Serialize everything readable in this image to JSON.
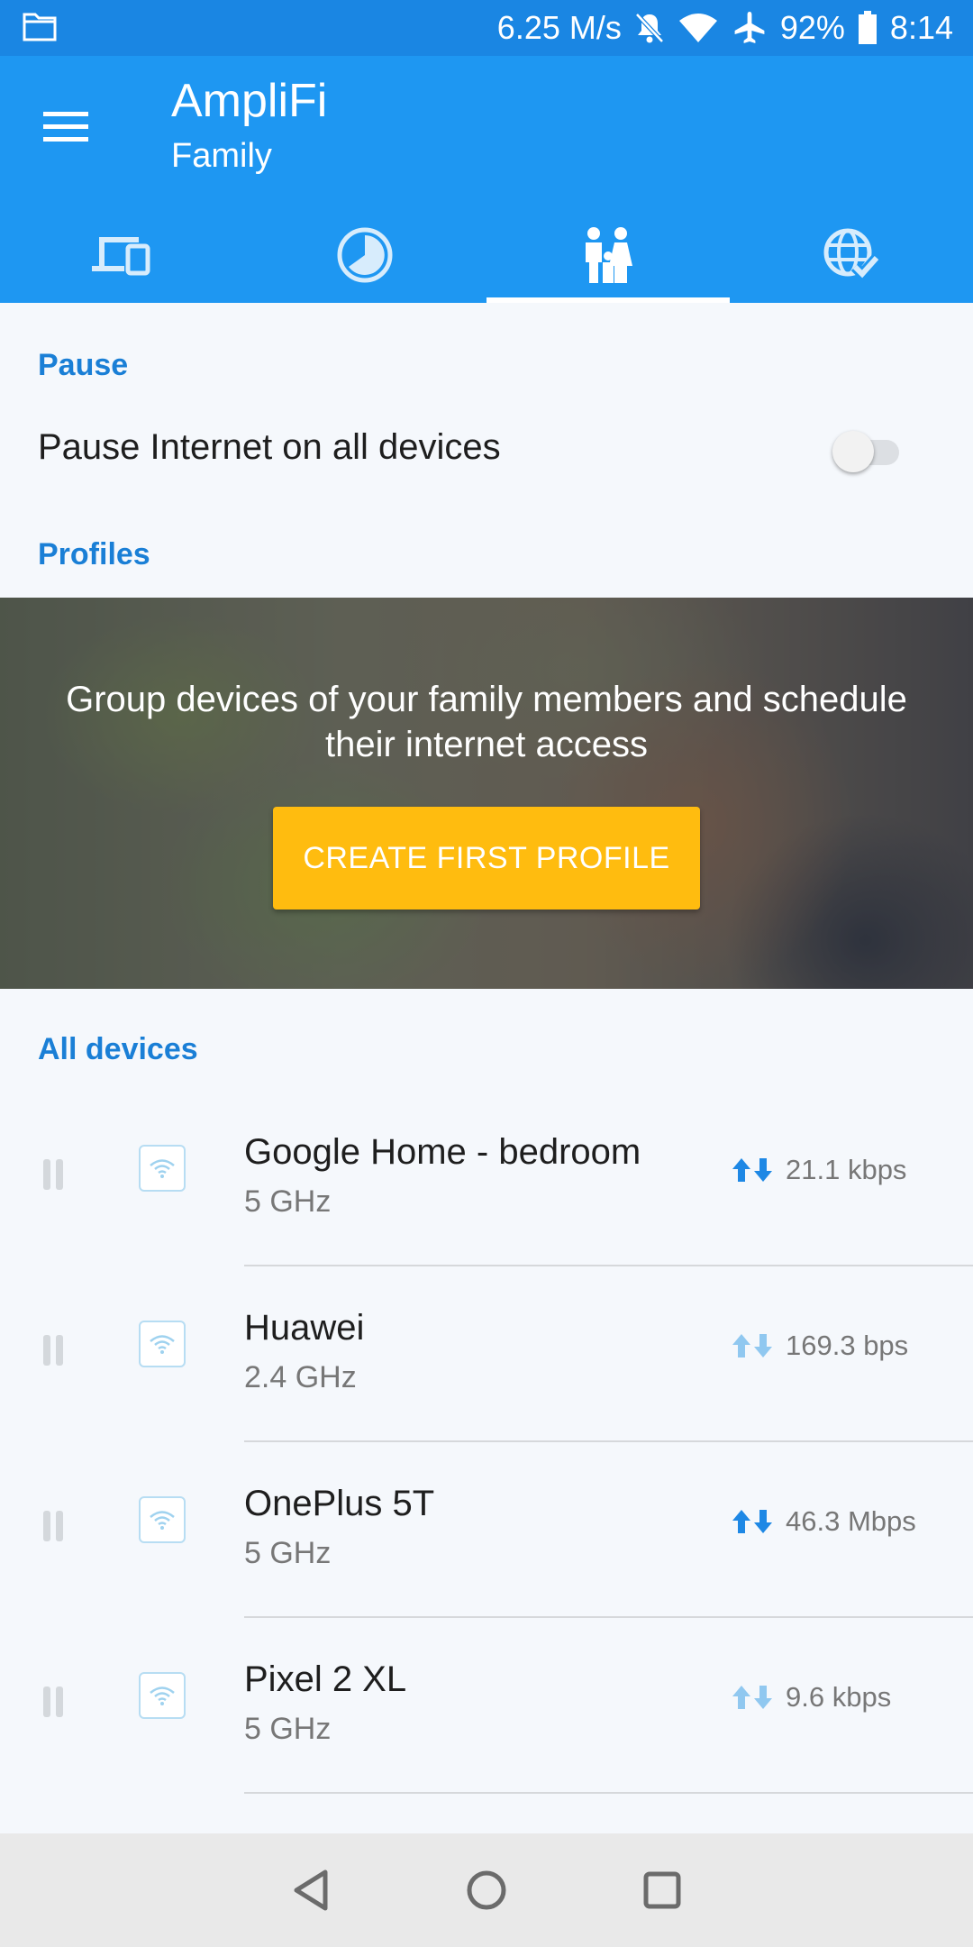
{
  "status_bar": {
    "speed": "6.25 M/s",
    "battery": "92%",
    "time": "8:14",
    "icons": [
      "folder-icon",
      "bell-off-icon",
      "wifi-icon",
      "airplane-icon",
      "battery-icon"
    ]
  },
  "app_bar": {
    "title": "AmpliFi",
    "subtitle": "Family",
    "tabs": [
      {
        "icon": "devices-icon",
        "active": false
      },
      {
        "icon": "usage-pie-icon",
        "active": false
      },
      {
        "icon": "family-icon",
        "active": true
      },
      {
        "icon": "internet-check-icon",
        "active": false
      }
    ]
  },
  "pause": {
    "header": "Pause",
    "label": "Pause Internet on all devices",
    "enabled": false
  },
  "profiles": {
    "header": "Profiles",
    "banner_text": "Group devices of your family members and schedule their internet access",
    "button": "CREATE FIRST PROFILE"
  },
  "all_devices": {
    "header": "All devices",
    "items": [
      {
        "name": "Google Home - bedroom",
        "band": "5 GHz",
        "rate": "21.1 kbps",
        "active_transfer": true
      },
      {
        "name": "Huawei",
        "band": "2.4 GHz",
        "rate": "169.3 bps",
        "active_transfer": false
      },
      {
        "name": "OnePlus 5T",
        "band": "5 GHz",
        "rate": "46.3 Mbps",
        "active_transfer": true
      },
      {
        "name": "Pixel 2 XL",
        "band": "5 GHz",
        "rate": "9.6 kbps",
        "active_transfer": false
      }
    ]
  },
  "colors": {
    "status_bar": "#1a86e3",
    "app_bar": "#1e97f2",
    "accent_text": "#1a7fd6",
    "cta": "#ffbc0f",
    "arrow_strong": "#1e88e5",
    "arrow_light": "#90c8f0"
  }
}
